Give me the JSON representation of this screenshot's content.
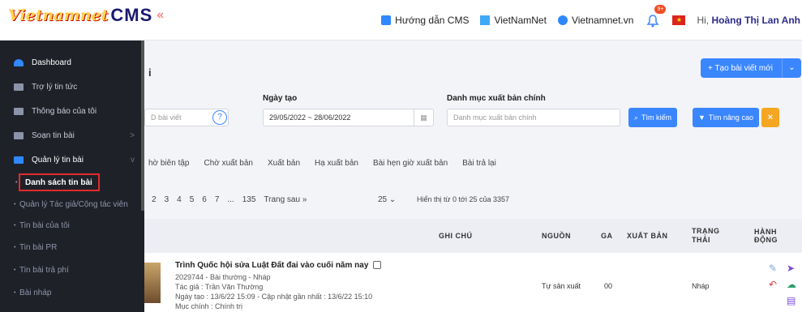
{
  "topbar": {
    "logo_vn": "Vietnamnet",
    "logo_cms": "CMS",
    "logo_chevron": "«",
    "links": [
      {
        "label": "Hướng dẫn CMS",
        "color": "#2f88ff"
      },
      {
        "label": "VietNamNet",
        "color": "#2f88ff"
      },
      {
        "label": "Vietnamnet.vn",
        "color": "#2f88ff"
      }
    ],
    "bell_badge": "9+",
    "flag": "★",
    "greeting": "Hi,",
    "user": "Hoàng Thị Lan Anh"
  },
  "sidebar": {
    "items": [
      {
        "label": "Dashboard",
        "active": true
      },
      {
        "label": "Trợ lý tin tức"
      },
      {
        "label": "Thông báo của tôi"
      },
      {
        "label": "Soạn tin bài",
        "arrow": ">"
      },
      {
        "label": "Quản lý tin bài",
        "arrow": "v"
      }
    ],
    "subs": [
      "Danh sách tin bài",
      "Quản lý Tác giả/Cộng tác viên",
      "Tin bài của tôi",
      "Tin bài PR",
      "Tin bài trả phí",
      "Bài nháp"
    ]
  },
  "main": {
    "heading_fragment": "i",
    "create_button": "+ Tạo bài viết mới",
    "create_dd": "❯",
    "filters": {
      "id_placeholder": "D bài viết",
      "date_label": "Ngày tạo",
      "date_value": "29/05/2022 ~ 28/06/2022",
      "category_label": "Danh mục xuất bản chính",
      "category_placeholder": "Danh mục xuất bản chính",
      "search_btn": "Tìm kiếm",
      "advanced_btn": "Tìm nâng cao",
      "clear_btn": "×",
      "help": "?"
    },
    "tabs": [
      "hờ biên tập",
      "Chờ xuất bản",
      "Xuất bản",
      "Hạ xuất bản",
      "Bài hẹn giờ xuất bản",
      "Bài trả lại"
    ],
    "pager": [
      "2",
      "3",
      "4",
      "5",
      "6",
      "7",
      "...",
      "135",
      "Trang sau »"
    ],
    "page_size": "25 ⌄",
    "page_info": "Hiển thị từ 0 tới 25 của 3357"
  },
  "table": {
    "headers": {
      "note": "GHI CHÚ",
      "source": "NGUỒN",
      "ga": "GA",
      "publish": "XUẤT BẢN",
      "status": "TRẠNG THÁI",
      "actions": "HÀNH ĐỘNG"
    },
    "row": {
      "title": "Trình Quốc hội sửa Luật Đất đai vào cuối năm nay",
      "line1": "2029744 - Bài thường - Nháp",
      "line2": "Tác giả : Trần Văn Thường",
      "line3": "Ngày tạo : 13/6/22 15:09 - Cập nhật gần nhất : 13/6/22 15:10",
      "line4": "Mục chính : Chính trị",
      "source": "Tự sản xuất",
      "ga": "00",
      "status": "Nháp"
    }
  },
  "colors": {
    "accent": "#3a86ff",
    "sidebar": "#1f2129",
    "highlight": "#e02b2b",
    "orange": "#f5a623"
  }
}
